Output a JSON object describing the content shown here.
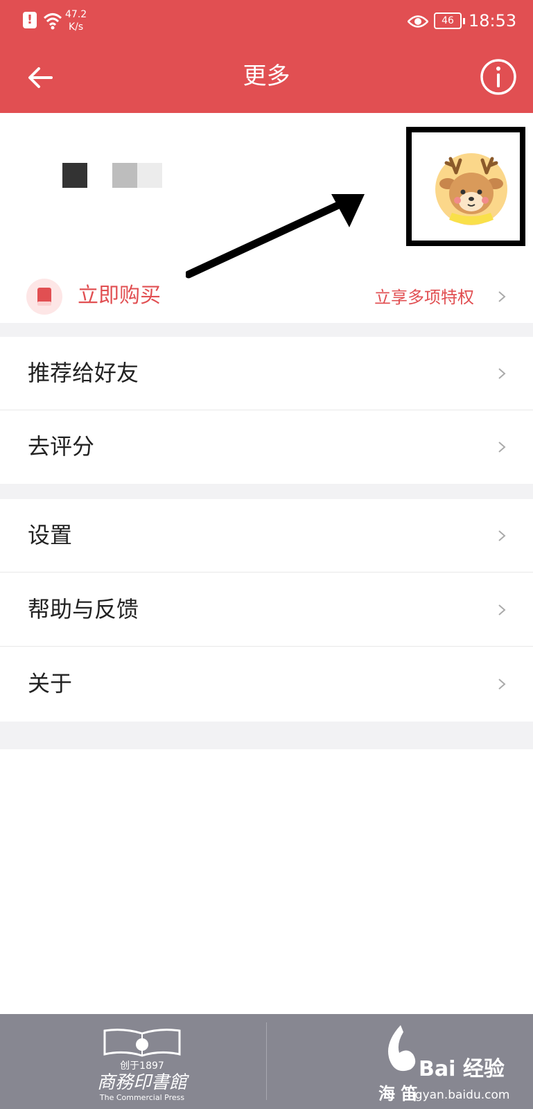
{
  "status_bar": {
    "alert_glyph": "!",
    "network_speed_value": "47.2",
    "network_speed_unit": "K/s",
    "battery_level": "46",
    "time": "18:53"
  },
  "top_bar": {
    "title": "更多",
    "back_icon": "arrow-left-icon",
    "info_icon": "info-circle-icon"
  },
  "profile": {
    "avatar_icon": "deer-avatar-icon"
  },
  "purchase": {
    "label": "立即购买",
    "privilege_text": "立享多项特权",
    "icon": "book-icon"
  },
  "menu_groups": {
    "group1": [
      {
        "label": "推荐给好友"
      },
      {
        "label": "去评分"
      }
    ],
    "group2": [
      {
        "label": "设置"
      },
      {
        "label": "帮助与反馈"
      },
      {
        "label": "关于"
      }
    ]
  },
  "footer": {
    "publisher_year": "创于1897",
    "publisher_name": "商務印書館",
    "publisher_english": "The Commercial Press",
    "haibei_name": "海 笛",
    "baidu_brand": "Bai 经验",
    "baidu_url": "ngyan.baidu.com"
  },
  "colors": {
    "brand_red": "#e14f52",
    "background_gray": "#f2f2f4",
    "footer_gray": "#878791"
  }
}
